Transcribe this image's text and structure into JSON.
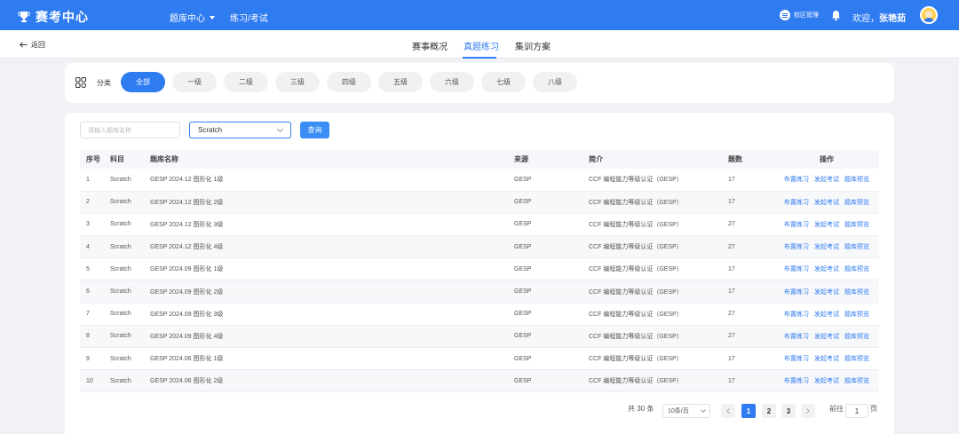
{
  "header": {
    "app_title": "赛考中心",
    "nav": [
      {
        "label": "题库中心"
      },
      {
        "label": "练习/考试"
      }
    ],
    "campus_label": "校区管理",
    "welcome_prefix": "欢迎，",
    "user_name": "张艳茹"
  },
  "subnav": {
    "back_label": "返回",
    "tabs": [
      {
        "label": "赛事概况"
      },
      {
        "label": "真题练习"
      },
      {
        "label": "集训方案"
      }
    ],
    "active_tab": "真题练习"
  },
  "category": {
    "label": "分类",
    "chips": [
      "全部",
      "一级",
      "二级",
      "三级",
      "四级",
      "五级",
      "六级",
      "七级",
      "八级"
    ],
    "active": "全部"
  },
  "filters": {
    "search_placeholder": "请输入题库名称",
    "subject_selected": "Scratch",
    "query_label": "查询"
  },
  "table": {
    "headers": [
      "序号",
      "科目",
      "题库名称",
      "来源",
      "简介",
      "题数",
      "操作"
    ],
    "rows": [
      {
        "idx": "1",
        "subject": "Scratch",
        "name": "GESP 2024.12 图形化 1级",
        "source": "GESP",
        "desc": "CCF 编程能力等级认证（GESP）",
        "count": "17"
      },
      {
        "idx": "2",
        "subject": "Scratch",
        "name": "GESP 2024.12 图形化 2级",
        "source": "GESP",
        "desc": "CCF 编程能力等级认证（GESP）",
        "count": "17"
      },
      {
        "idx": "3",
        "subject": "Scratch",
        "name": "GESP 2024.12 图形化 3级",
        "source": "GESP",
        "desc": "CCF 编程能力等级认证（GESP）",
        "count": "27"
      },
      {
        "idx": "4",
        "subject": "Scratch",
        "name": "GESP 2024.12 图形化 4级",
        "source": "GESP",
        "desc": "CCF 编程能力等级认证（GESP）",
        "count": "27"
      },
      {
        "idx": "5",
        "subject": "Scratch",
        "name": "GESP 2024.09 图形化 1级",
        "source": "GESP",
        "desc": "CCF 编程能力等级认证（GESP）",
        "count": "17"
      },
      {
        "idx": "6",
        "subject": "Scratch",
        "name": "GESP 2024.09 图形化 2级",
        "source": "GESP",
        "desc": "CCF 编程能力等级认证（GESP）",
        "count": "17"
      },
      {
        "idx": "7",
        "subject": "Scratch",
        "name": "GESP 2024.09 图形化 3级",
        "source": "GESP",
        "desc": "CCF 编程能力等级认证（GESP）",
        "count": "27"
      },
      {
        "idx": "8",
        "subject": "Scratch",
        "name": "GESP 2024.09 图形化 4级",
        "source": "GESP",
        "desc": "CCF 编程能力等级认证（GESP）",
        "count": "27"
      },
      {
        "idx": "9",
        "subject": "Scratch",
        "name": "GESP 2024.06 图形化 1级",
        "source": "GESP",
        "desc": "CCF 编程能力等级认证（GESP）",
        "count": "17"
      },
      {
        "idx": "10",
        "subject": "Scratch",
        "name": "GESP 2024.06 图形化 2级",
        "source": "GESP",
        "desc": "CCF 编程能力等级认证（GESP）",
        "count": "17"
      }
    ],
    "ops": [
      "布置练习",
      "发起考试",
      "题库预览"
    ]
  },
  "pagination": {
    "total_label": "共 30 条",
    "page_size": "10条/页",
    "pages": [
      "1",
      "2",
      "3"
    ],
    "current": "1",
    "goto_prefix": "前往",
    "goto_value": "1",
    "goto_suffix": "页"
  },
  "colors": {
    "accent": "#2f7bf0",
    "chip_bg": "#f0f1f3",
    "page_bg": "#f0f2f5"
  }
}
